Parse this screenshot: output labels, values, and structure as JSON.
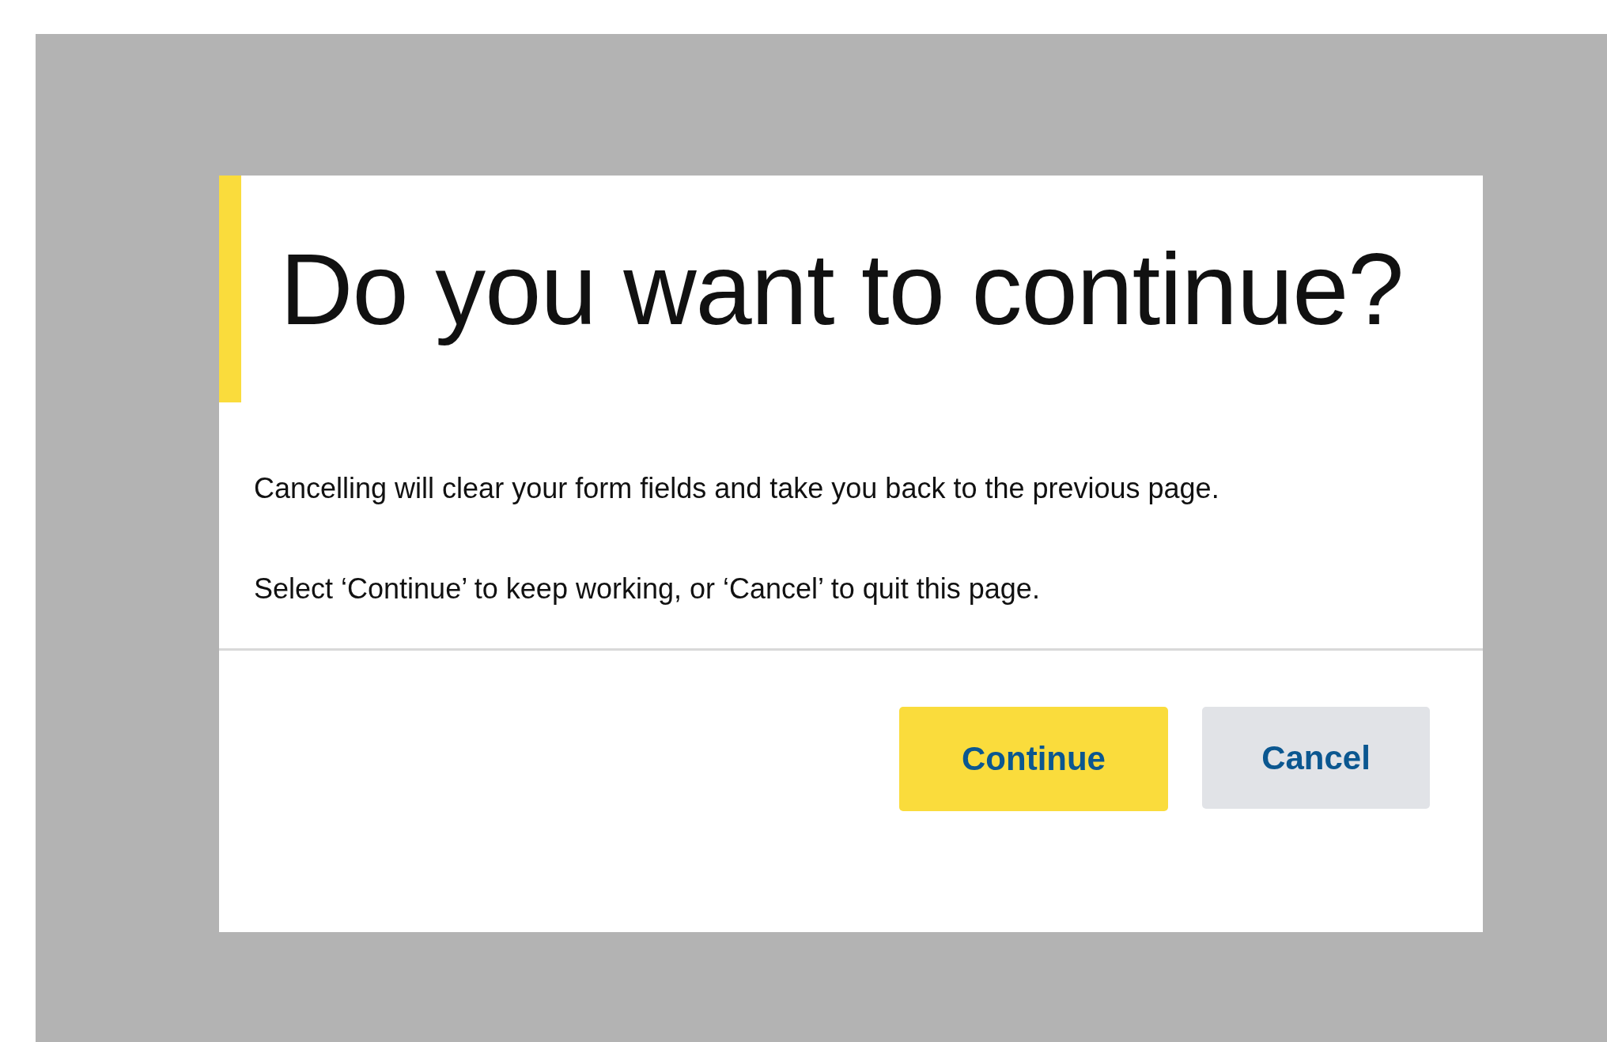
{
  "dialog": {
    "title": "Do you want to continue?",
    "paragraphs": [
      "Cancelling will clear your form fields and take you back to the previous page.",
      "Select ‘Continue’ to keep working, or ‘Cancel’ to quit this page."
    ],
    "buttons": [
      {
        "label": "Continue",
        "kind": "primary"
      },
      {
        "label": "Cancel",
        "kind": "secondary"
      }
    ]
  }
}
